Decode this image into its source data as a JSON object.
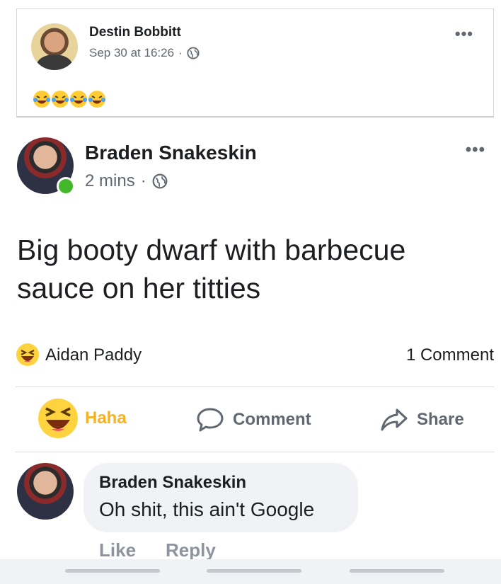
{
  "top_post": {
    "author": "Destin Bobbitt",
    "timestamp": "Sep 30 at 16:26",
    "separator": "·",
    "privacy_icon": "globe-icon",
    "menu": "•••",
    "emojis": [
      "crying-laughing-emoji",
      "crying-laughing-emoji",
      "crying-laughing-emoji",
      "crying-laughing-emoji"
    ]
  },
  "post": {
    "author": "Braden Snakeskin",
    "timestamp": "2 mins",
    "separator": "·",
    "privacy_icon": "globe-icon",
    "menu": "•••",
    "online": true,
    "text": "Big booty dwarf with barbecue sauce on her titties"
  },
  "reactions": {
    "type": "haha",
    "reactor": "Aidan Paddy",
    "comment_count_label": "1 Comment"
  },
  "actions": {
    "haha": "Haha",
    "comment": "Comment",
    "share": "Share"
  },
  "comment": {
    "author": "Braden Snakeskin",
    "text": "Oh shit, this ain't Google",
    "like": "Like",
    "reply": "Reply"
  },
  "colors": {
    "haha_active": "#f7b125",
    "online": "#42b72a",
    "secondary_text": "#606770",
    "bubble": "#f0f2f5"
  }
}
